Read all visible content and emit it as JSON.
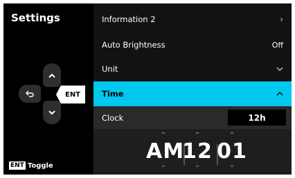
{
  "title": "Settings",
  "hint": {
    "key": "ENT",
    "label": "Toggle"
  },
  "dpad": {
    "ent_label": "ENT",
    "back_icon": "back-arrow",
    "up_icon": "chevron-up",
    "down_icon": "chevron-down"
  },
  "menu": {
    "information": {
      "label": "Information 2",
      "chevron": "›"
    },
    "auto_brightness": {
      "label": "Auto Brightness",
      "value": "Off"
    },
    "unit": {
      "label": "Unit",
      "chevron": "⌄"
    },
    "time": {
      "label": "Time",
      "chevron": "^"
    },
    "clock": {
      "label": "Clock",
      "value": "12h"
    }
  },
  "picker": {
    "ampm": "AM",
    "hour": "12",
    "minute": "01"
  },
  "colors": {
    "accent": "#00c8ee",
    "background": "#000000"
  }
}
